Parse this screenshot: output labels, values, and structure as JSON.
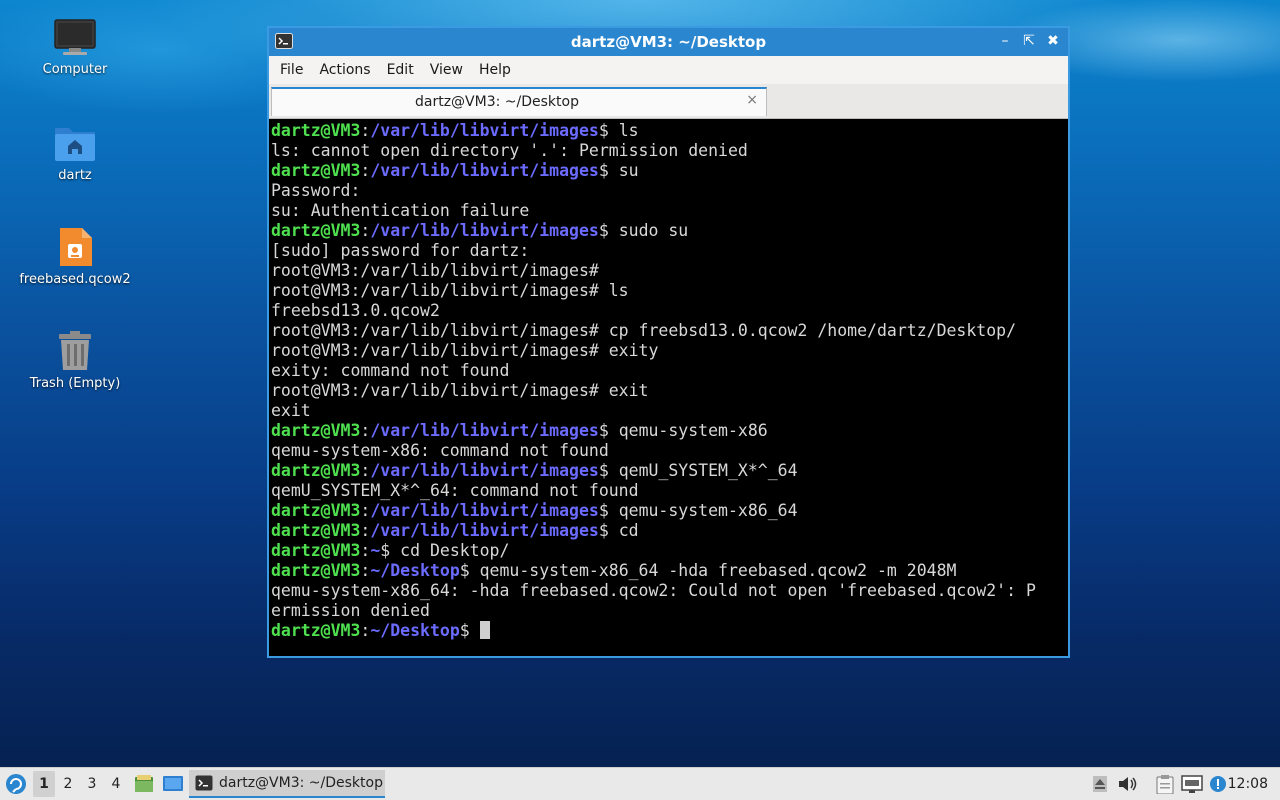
{
  "desktop": {
    "icons": [
      {
        "label": "Computer",
        "icon": "monitor-icon"
      },
      {
        "label": "dartz",
        "icon": "home-folder-icon"
      },
      {
        "label": "freebased.qcow2",
        "icon": "presentation-file-icon"
      },
      {
        "label": "Trash (Empty)",
        "icon": "trash-icon"
      }
    ]
  },
  "window": {
    "title": "dartz@VM3: ~/Desktop",
    "controls": [
      "minimize",
      "maximize",
      "close"
    ],
    "menu": [
      "File",
      "Actions",
      "Edit",
      "View",
      "Help"
    ],
    "tab": {
      "label": "dartz@VM3: ~/Desktop",
      "close": "×"
    }
  },
  "terminal": {
    "colors": {
      "user": "#4fe04f",
      "path": "#6b6bff",
      "text": "#d8d8d8",
      "background": "#000000"
    },
    "lines": [
      {
        "user": "dartz@VM3",
        "sep": ":",
        "path": "/var/lib/libvirt/images",
        "rest": "$ ls"
      },
      {
        "text": "ls: cannot open directory '.': Permission denied"
      },
      {
        "user": "dartz@VM3",
        "sep": ":",
        "path": "/var/lib/libvirt/images",
        "rest": "$ su"
      },
      {
        "text": "Password:"
      },
      {
        "text": "su: Authentication failure"
      },
      {
        "user": "dartz@VM3",
        "sep": ":",
        "path": "/var/lib/libvirt/images",
        "rest": "$ sudo su"
      },
      {
        "text": "[sudo] password for dartz:"
      },
      {
        "text": "root@VM3:/var/lib/libvirt/images#"
      },
      {
        "text": "root@VM3:/var/lib/libvirt/images# ls"
      },
      {
        "text": "freebsd13.0.qcow2"
      },
      {
        "text": "root@VM3:/var/lib/libvirt/images# cp freebsd13.0.qcow2 /home/dartz/Desktop/"
      },
      {
        "text": "root@VM3:/var/lib/libvirt/images# exity"
      },
      {
        "text": "exity: command not found"
      },
      {
        "text": "root@VM3:/var/lib/libvirt/images# exit"
      },
      {
        "text": "exit"
      },
      {
        "user": "dartz@VM3",
        "sep": ":",
        "path": "/var/lib/libvirt/images",
        "rest": "$ qemu-system-x86"
      },
      {
        "text": "qemu-system-x86: command not found"
      },
      {
        "user": "dartz@VM3",
        "sep": ":",
        "path": "/var/lib/libvirt/images",
        "rest": "$ qemU_SYSTEM_X*^_64"
      },
      {
        "text": "qemU_SYSTEM_X*^_64: command not found"
      },
      {
        "user": "dartz@VM3",
        "sep": ":",
        "path": "/var/lib/libvirt/images",
        "rest": "$ qemu-system-x86_64"
      },
      {
        "user": "dartz@VM3",
        "sep": ":",
        "path": "/var/lib/libvirt/images",
        "rest": "$ cd"
      },
      {
        "user": "dartz@VM3",
        "sep": ":",
        "path": "~",
        "rest": "$ cd Desktop/"
      },
      {
        "user": "dartz@VM3",
        "sep": ":",
        "path": "~/Desktop",
        "rest": "$ qemu-system-x86_64 -hda freebased.qcow2 -m 2048M"
      },
      {
        "text": "qemu-system-x86_64: -hda freebased.qcow2: Could not open 'freebased.qcow2': P"
      },
      {
        "text": "ermission denied"
      },
      {
        "user": "dartz@VM3",
        "sep": ":",
        "path": "~/Desktop",
        "rest": "$ ",
        "cursor": true
      }
    ]
  },
  "taskbar": {
    "workspaces": [
      "1",
      "2",
      "3",
      "4"
    ],
    "active_workspace": "1",
    "task_label": "dartz@VM3: ~/Desktop",
    "clock": "12:08",
    "tray_icons": [
      "eject-icon",
      "volume-icon",
      "clipboard-icon",
      "network-icon",
      "update-notifier-icon"
    ]
  }
}
